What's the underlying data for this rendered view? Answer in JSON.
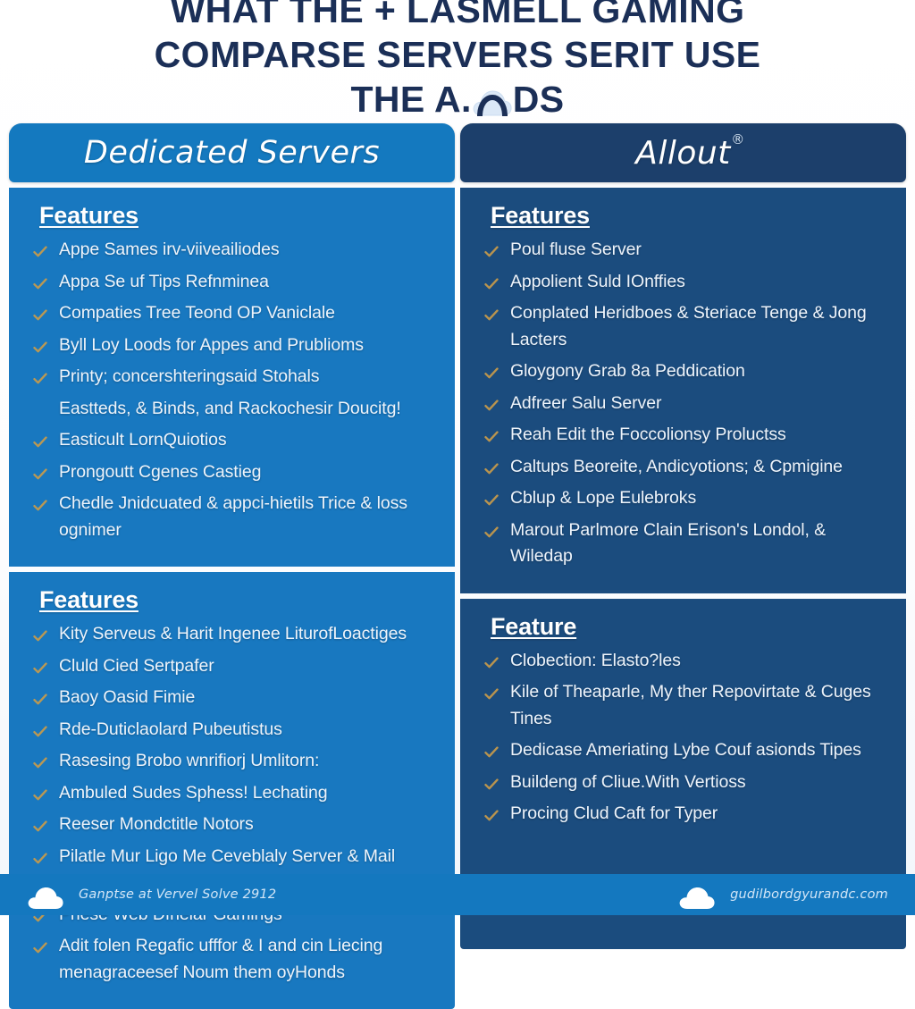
{
  "title": {
    "line1": "WHAT THE + LASMELL GAMING",
    "line2": "COMPARSE SERVERS SERIT USE",
    "line3_before": "THE A.",
    "line3_after": "DS",
    "cloud_icon": "cloud-icon"
  },
  "colors": {
    "title_text": "#1b2f57",
    "left_header_bg": "#1479bf",
    "left_body_bg": "#1878c0",
    "right_header_bg": "#1c3f6b",
    "right_body_bg": "#1b4c7e",
    "check_gold": "#c89b4a",
    "footer_bg": "#1478bf",
    "body_text": "#eef4fb"
  },
  "columns": [
    {
      "id": "left",
      "header": "Dedicated Servers",
      "header_registered": false,
      "sections": [
        {
          "title": "Features",
          "items": [
            {
              "text": "Appe Sames irv-viiveailiodes",
              "check": true
            },
            {
              "text": "Appa Se uf Tips Refnminea",
              "check": true
            },
            {
              "text": "Compaties Tree Teond OP Vaniclale",
              "check": true
            },
            {
              "text": "Byll Loy Loods for Appes and Prublioms",
              "check": true
            },
            {
              "text": "Printy; concershteringsaid Stohals",
              "check": true
            },
            {
              "text": "Eastteds, & Binds, and Rackochesir Doucitg!",
              "check": false
            },
            {
              "text": "Easticult LornQuiotios",
              "check": true
            },
            {
              "text": "Prongoutt Cgenes Castieg",
              "check": true
            },
            {
              "text": "Chedle Jnidcuated & appci-hietils Trice & loss ognimer",
              "check": true
            }
          ]
        },
        {
          "title": "Features",
          "items": [
            {
              "text": "Kity Serveus & Harit Ingenee LiturofLoactiges",
              "check": true
            },
            {
              "text": "Cluld Cied Sertpafer",
              "check": true
            },
            {
              "text": "Baoy Oasid Fimie",
              "check": true
            },
            {
              "text": "Rde-Duticlaolard Pubeutistus",
              "check": true
            },
            {
              "text": "Rasesing Brobo wnrifiorj Umlitorn:",
              "check": true
            },
            {
              "text": "Ambuled Sudes Sphess! Lechating",
              "check": true
            },
            {
              "text": "Reeser Mondctitle Notors",
              "check": true
            },
            {
              "text": "Pilatle Mur Ligo Me Ceveblaly Server & Mail factiuer.",
              "check": true
            },
            {
              "text": "Phese Web Dfnelar Gamings",
              "check": true
            },
            {
              "text": "Adit folen Regafic ufffor & I and cin Liecing menagraceesef Noum them oyHonds",
              "check": true
            }
          ]
        }
      ]
    },
    {
      "id": "right",
      "header": "Allout",
      "header_registered": true,
      "sections": [
        {
          "title": "Features",
          "items": [
            {
              "text": "Poul fluse Server",
              "check": true
            },
            {
              "text": "Appolient Suld IOnffies",
              "check": true
            },
            {
              "text": "Conplated Heridboes & Steriace Tenge & Jong Lacters",
              "check": true
            },
            {
              "text": "Gloygony Grab 8a Peddication",
              "check": true
            },
            {
              "text": "Adfreer Salu Server",
              "check": true
            },
            {
              "text": "Reah Edit the Foccolionsy Proluctss",
              "check": true
            },
            {
              "text": "Caltups Beoreite, Andicyotions; & Cpmigine",
              "check": true
            },
            {
              "text": "Cblup & Lope Eulebroks",
              "check": true
            },
            {
              "text": "Marout Parlmore Clain Erison's Londol, & Wiledap",
              "check": true
            }
          ]
        },
        {
          "title": "Feature",
          "items": [
            {
              "text": "Clobection: Elasto?les",
              "check": true
            },
            {
              "text": "Kile of Theaparle, My ther Repovirtate & Cuges Tines",
              "check": true
            },
            {
              "text": "Dedicase Ameriating Lybe Couf asionds Tipes",
              "check": true
            },
            {
              "text": "Buildeng of Cliue.With Vertioss",
              "check": true
            },
            {
              "text": "Procing Clud Caft for Typer",
              "check": true
            }
          ]
        }
      ]
    }
  ],
  "footer": {
    "left_text": "Ganptse at Vervel Solve 2912",
    "right_text": "gudilbordgyurandc.com",
    "left_icon": "cloud-icon",
    "right_icon": "cloud-icon"
  }
}
